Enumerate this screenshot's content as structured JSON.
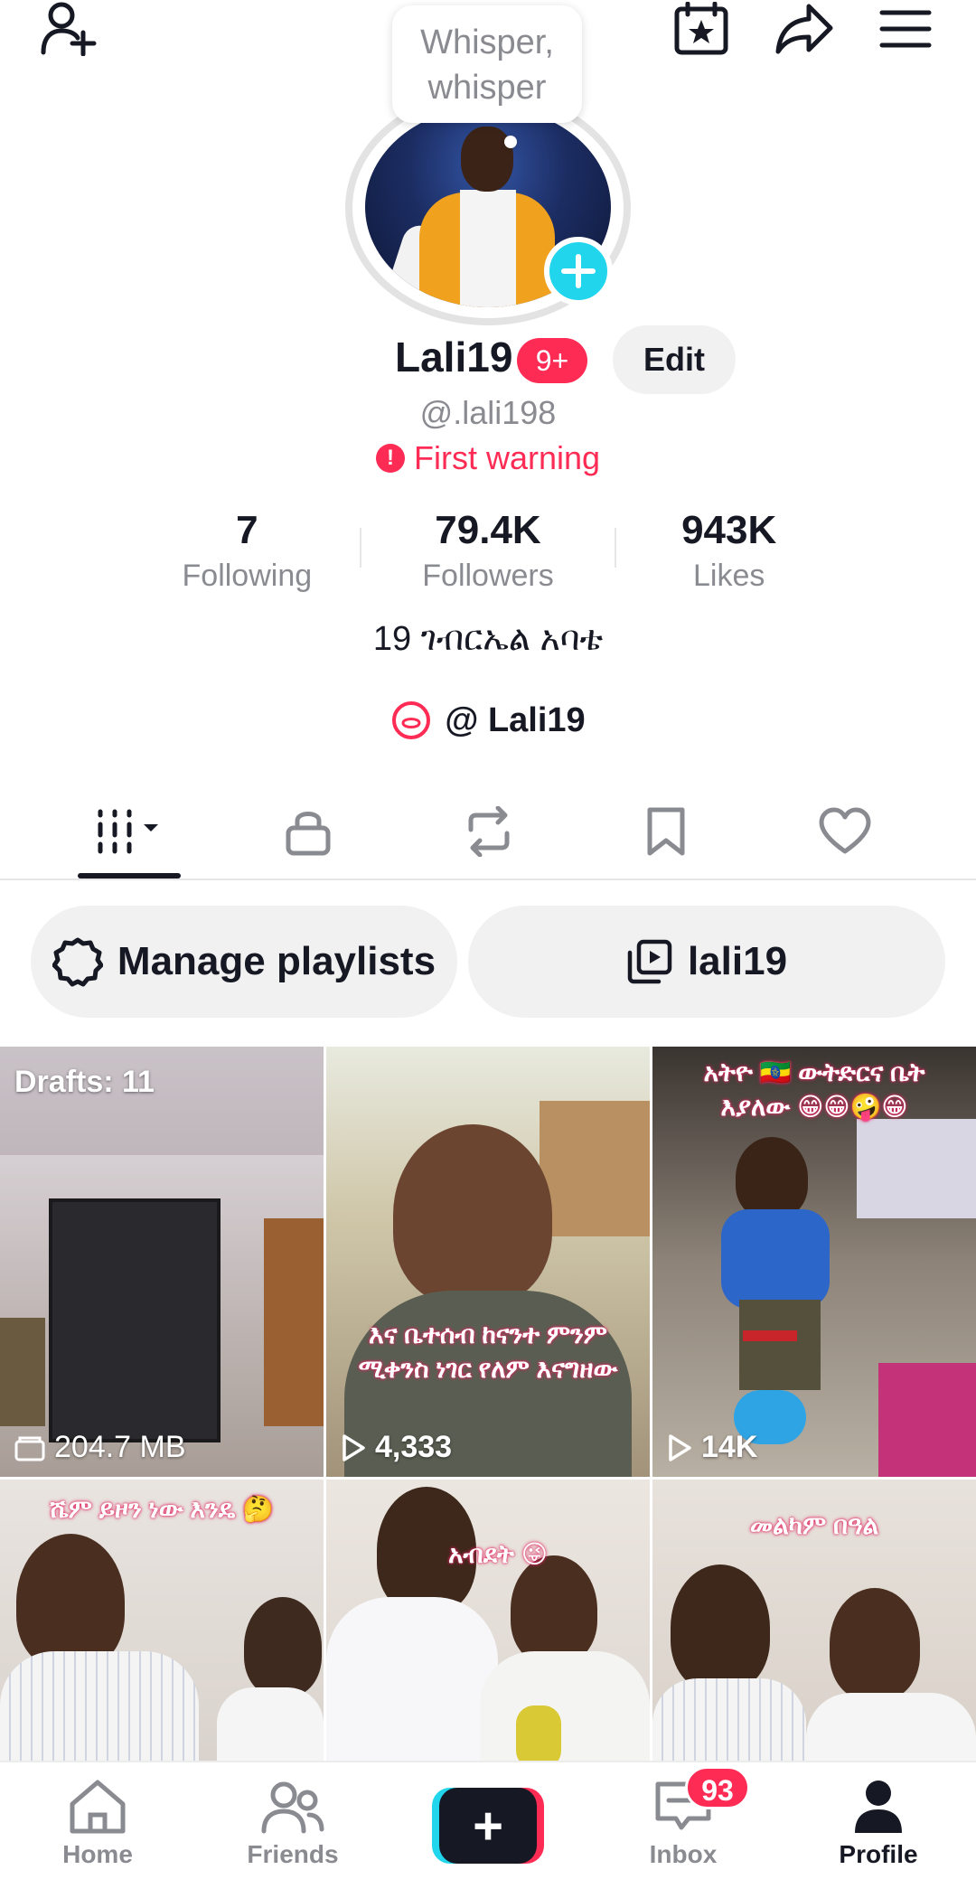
{
  "header": {
    "bubble_line1": "Whisper,",
    "bubble_line2": "whisper"
  },
  "profile": {
    "username": "Lali19",
    "notification_badge": "9+",
    "edit_label": "Edit",
    "handle": "@.lali198",
    "warning_text": "First warning",
    "warning_icon": "!",
    "bio": "19 ገብርኤል አባቴ",
    "link_text": "@ Lali19"
  },
  "stats": [
    {
      "value": "7",
      "label": "Following"
    },
    {
      "value": "79.4K",
      "label": "Followers"
    },
    {
      "value": "943K",
      "label": "Likes"
    }
  ],
  "actions": {
    "manage_playlists": "Manage playlists",
    "playlist_name": "lali19"
  },
  "videos": [
    {
      "top_label": "Drafts: 11",
      "bottom_label": "204.7 MB",
      "caption": ""
    },
    {
      "top_label": "",
      "bottom_label": "4,333",
      "caption": "እና ቤተሰብ ከናንተ ምንም ሚቀንስ ነገር የለም እናግዘው"
    },
    {
      "top_label": "",
      "bottom_label": "14K",
      "caption": "አትዮ 🇪🇹 ውትድርና ቤት እያለው 😁😁🤪😁"
    },
    {
      "top_label": "",
      "bottom_label": "",
      "caption": "ሼም ይዞን ነው እንዴ 🤔"
    },
    {
      "top_label": "",
      "bottom_label": "",
      "caption": "አብደት 😜"
    },
    {
      "top_label": "",
      "bottom_label": "",
      "caption": "መልካም በዓል"
    }
  ],
  "bottom_nav": {
    "home": "Home",
    "friends": "Friends",
    "inbox": "Inbox",
    "inbox_badge": "93",
    "profile": "Profile",
    "create": "+"
  },
  "colors": {
    "accent_red": "#fe2c55",
    "accent_cyan": "#20d5ec",
    "text_primary": "#161823",
    "text_secondary": "#8a8b91"
  }
}
